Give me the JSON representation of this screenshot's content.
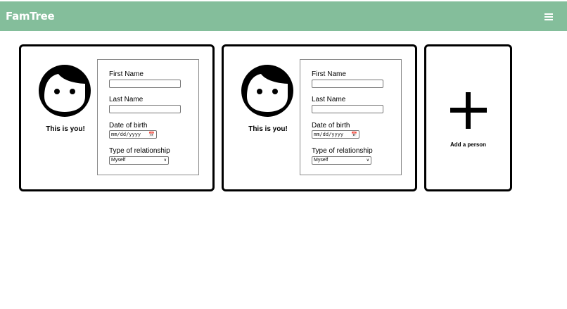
{
  "app": {
    "title": "FamTree"
  },
  "header": {
    "menu_icon": "hamburger-menu-icon",
    "accent_color": "#84be9b"
  },
  "people": [
    {
      "avatar_icon": "person-face-icon",
      "caption": "This is you!",
      "fields": {
        "first_name_label": "First Name",
        "first_name_value": "",
        "last_name_label": "Last Name",
        "last_name_value": "",
        "dob_label": "Date of birth",
        "dob_placeholder": "mm/dd/yyyy",
        "relationship_label": "Type of relationship",
        "relationship_value": "Myself"
      }
    },
    {
      "avatar_icon": "person-face-icon",
      "caption": "This is you!",
      "fields": {
        "first_name_label": "First Name",
        "first_name_value": "",
        "last_name_label": "Last Name",
        "last_name_value": "",
        "dob_label": "Date of birth",
        "dob_placeholder": "mm/dd/yyyy",
        "relationship_label": "Type of relationship",
        "relationship_value": "Myself"
      }
    }
  ],
  "add_person": {
    "icon": "plus-icon",
    "label": "Add a person"
  }
}
